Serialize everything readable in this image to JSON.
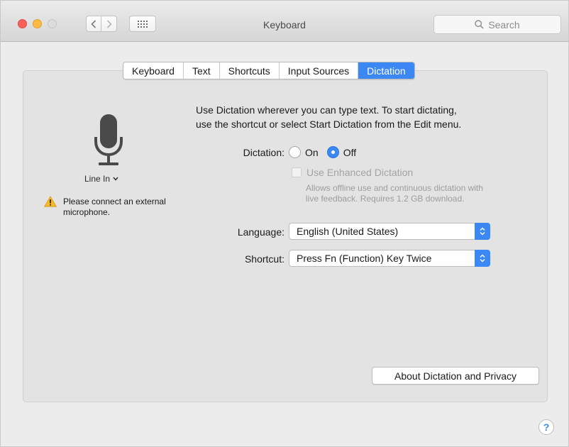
{
  "window": {
    "title": "Keyboard",
    "search_placeholder": "Search"
  },
  "tabs": [
    {
      "label": "Keyboard",
      "active": false
    },
    {
      "label": "Text",
      "active": false
    },
    {
      "label": "Shortcuts",
      "active": false
    },
    {
      "label": "Input Sources",
      "active": false
    },
    {
      "label": "Dictation",
      "active": true
    }
  ],
  "left": {
    "input_source": "Line In",
    "warning_line1": "Please connect an external",
    "warning_line2": "microphone."
  },
  "main": {
    "intro_line1": "Use Dictation wherever you can type text. To start dictating,",
    "intro_line2": "use the shortcut or select Start Dictation from the Edit menu.",
    "dictation_label": "Dictation:",
    "dictation_on": "On",
    "dictation_off": "Off",
    "dictation_selected": "Off",
    "enhanced_label": "Use Enhanced Dictation",
    "enhanced_help_line1": "Allows offline use and continuous dictation with",
    "enhanced_help_line2": "live feedback. Requires 1.2 GB download.",
    "language_label": "Language:",
    "language_value": "English (United States)",
    "shortcut_label": "Shortcut:",
    "shortcut_value": "Press Fn (Function) Key Twice",
    "about_button": "About Dictation and Privacy",
    "help_button": "?"
  },
  "colors": {
    "accent": "#3b88f5",
    "close": "#fc605b",
    "minimize": "#fdbc40",
    "warning": "#f5b82e"
  }
}
